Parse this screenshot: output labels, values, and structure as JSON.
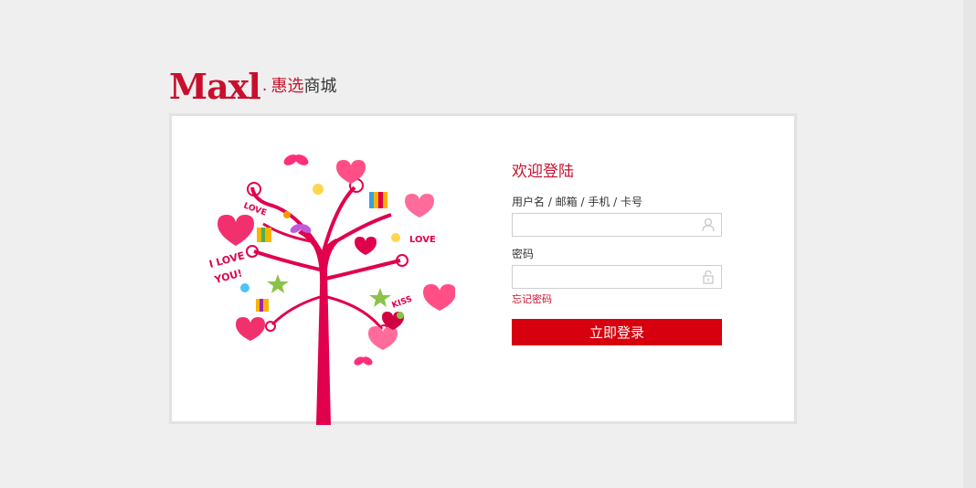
{
  "header": {
    "logo_text": "Maxl",
    "brand_red": "惠选",
    "brand_black": "商城"
  },
  "login": {
    "welcome": "欢迎登陆",
    "username_label": "用户名 / 邮箱 / 手机 / 卡号",
    "username_value": "",
    "password_label": "密码",
    "password_value": "",
    "forgot_password": "忘记密码",
    "submit_label": "立即登录"
  },
  "illustration": {
    "tree_texts": [
      "LOVE",
      "LOVE",
      "I LOVE",
      "YOU!",
      "KISS"
    ]
  },
  "colors": {
    "accent": "#c8102e",
    "button": "#d7000f",
    "background": "#efefef"
  },
  "icons": {
    "username_icon": "user-icon",
    "password_icon": "lock-icon"
  }
}
